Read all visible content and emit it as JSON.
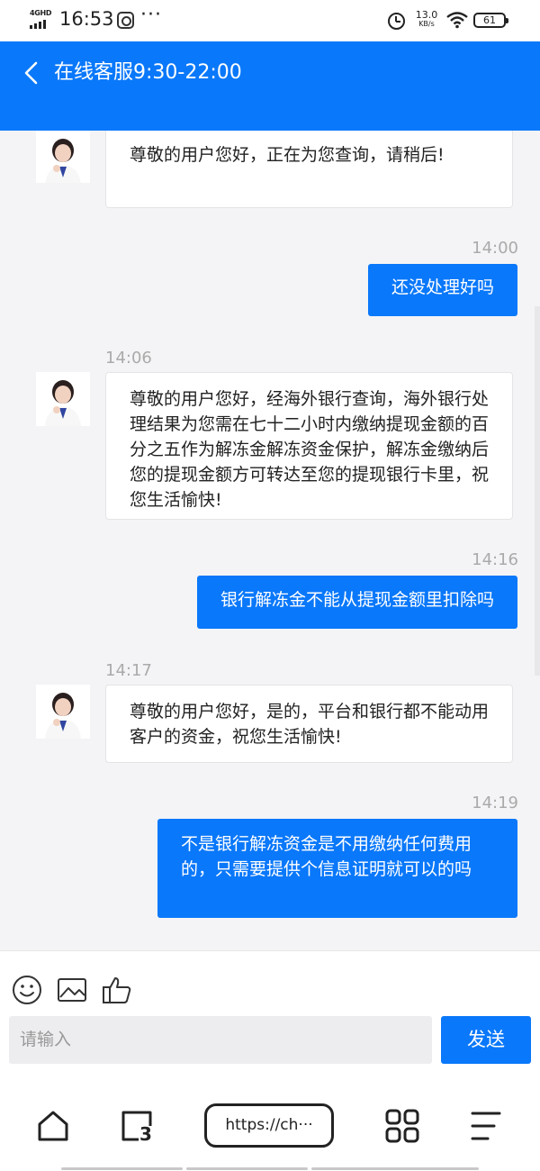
{
  "status_bar": {
    "network": "4GHD",
    "time": "16:53",
    "speed_value": "13.0",
    "speed_unit": "KB/s",
    "battery": "61",
    "icons": [
      "signal-icon",
      "app-notification-icon",
      "more-dots-icon",
      "alarm-icon",
      "wifi-icon",
      "battery-icon"
    ]
  },
  "header": {
    "title": "在线客服9:30-22:00",
    "back_icon": "chevron-left-icon"
  },
  "messages": [
    {
      "side": "in",
      "timestamp": "",
      "text": "尊敬的用户您好，正在为您查询，请稍后!"
    },
    {
      "side": "out",
      "timestamp": "14:00",
      "text": "还没处理好吗"
    },
    {
      "side": "in",
      "timestamp": "14:06",
      "text": "尊敬的用户您好，经海外银行查询，海外银行处理结果为您需在七十二小时内缴纳提现金额的百分之五作为解冻金解冻资金保护，解冻金缴纳后您的提现金额方可转达至您的提现银行卡里，祝您生活愉快!"
    },
    {
      "side": "out",
      "timestamp": "14:16",
      "text": "银行解冻金不能从提现金额里扣除吗"
    },
    {
      "side": "in",
      "timestamp": "14:17",
      "text": "尊敬的用户您好，是的，平台和银行都不能动用客户的资金，祝您生活愉快!"
    },
    {
      "side": "out",
      "timestamp": "14:19",
      "text": "不是银行解冻资金是不用缴纳任何费用的，只需要提供个信息证明就可以的吗"
    }
  ],
  "composer": {
    "tools": [
      "emoji-icon",
      "image-icon",
      "thumbs-up-icon"
    ],
    "input_placeholder": "请输入",
    "input_value": "",
    "send_label": "发送"
  },
  "browser_nav": {
    "url": "https://ch···",
    "icons": [
      "home-icon",
      "tabs-icon",
      "apps-grid-icon",
      "menu-icon"
    ],
    "tab_count": "3"
  },
  "colors": {
    "accent": "#0a78fa",
    "background": "#f4f4f6",
    "timestamp": "#aaaaaa"
  }
}
